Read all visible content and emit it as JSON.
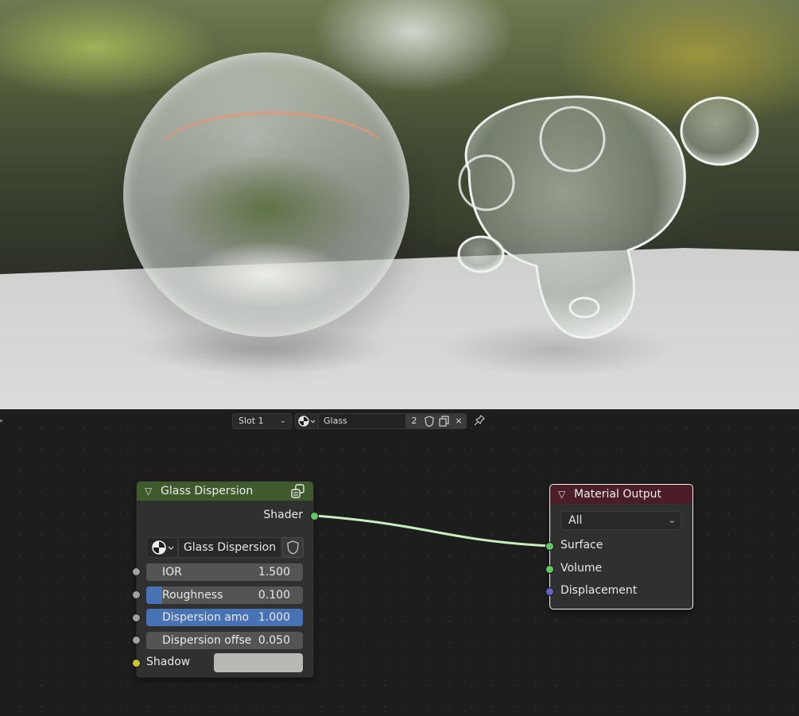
{
  "editor_header": {
    "slot": "Slot 1",
    "material_name": "Glass",
    "user_count": "2",
    "unlink_glyph": "×"
  },
  "glass_node": {
    "title": "Glass Dispersion",
    "output_socket": "Shader",
    "distribution": "Glass Dispersion",
    "inputs": [
      {
        "label": "IOR",
        "value": "1.500",
        "fill": 0
      },
      {
        "label": "Roughness",
        "value": "0.100",
        "fill": 0.1
      },
      {
        "label": "Dispersion amo",
        "value": "1.000",
        "fill": 1.0
      },
      {
        "label": "Dispersion offse",
        "value": "0.050",
        "fill": 0
      }
    ],
    "shadow_label": "Shadow",
    "shadow_color": "#b8b8b4"
  },
  "output_node": {
    "title": "Material Output",
    "target": "All",
    "sockets": [
      "Surface",
      "Volume",
      "Displacement"
    ]
  },
  "colors": {
    "shader_header": "#3f5a2c",
    "output_header": "#4a1d27",
    "link": "#c8eec0",
    "slider_fill": "#4772b3"
  }
}
